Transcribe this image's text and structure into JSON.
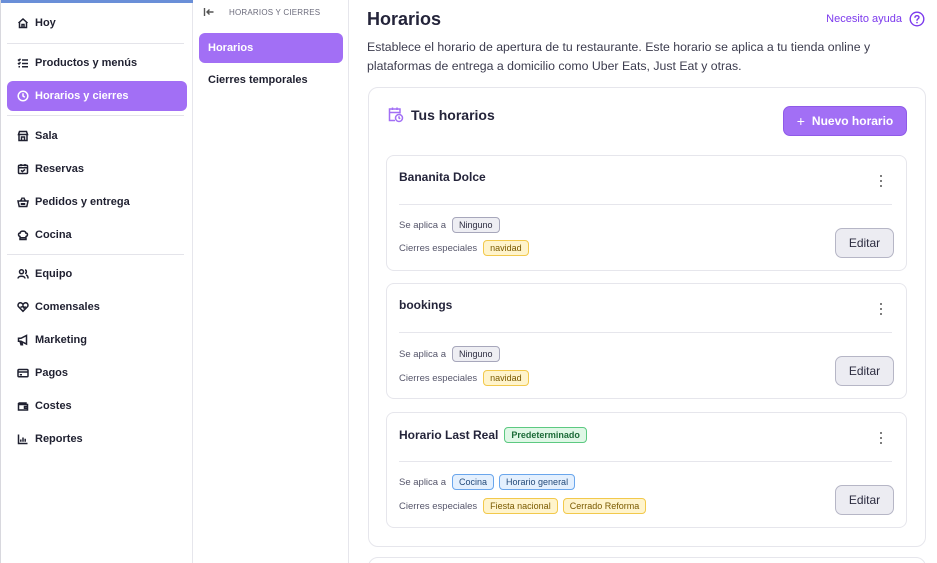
{
  "sidebar": {
    "items": [
      {
        "label": "Hoy",
        "icon": "home-icon"
      },
      {
        "label": "Productos y menús",
        "icon": "list-icon"
      },
      {
        "label": "Horarios y cierres",
        "icon": "clock-icon"
      },
      {
        "label": "Sala",
        "icon": "store-icon"
      },
      {
        "label": "Reservas",
        "icon": "calendar-icon"
      },
      {
        "label": "Pedidos y entrega",
        "icon": "basket-icon"
      },
      {
        "label": "Cocina",
        "icon": "chef-hat-icon"
      },
      {
        "label": "Equipo",
        "icon": "users-icon"
      },
      {
        "label": "Comensales",
        "icon": "heart-icon"
      },
      {
        "label": "Marketing",
        "icon": "megaphone-icon"
      },
      {
        "label": "Pagos",
        "icon": "card-icon"
      },
      {
        "label": "Costes",
        "icon": "wallet-icon"
      },
      {
        "label": "Reportes",
        "icon": "chart-icon"
      }
    ]
  },
  "subpanel": {
    "header": "HORARIOS Y CIERRES",
    "items": [
      {
        "label": "Horarios"
      },
      {
        "label": "Cierres temporales"
      }
    ]
  },
  "main": {
    "title": "Horarios",
    "help_label": "Necesito ayuda",
    "description": "Establece el horario de apertura de tu restaurante. Este horario se aplica a tu tienda online y plataformas de entrega a domicilio como Uber Eats, Just Eat y otras.",
    "card_title": "Tus horarios",
    "new_button_label": "Nuevo horario",
    "applies_label": "Se aplica a",
    "closures_label": "Cierres especiales",
    "edit_label": "Editar",
    "schedules": [
      {
        "name": "Bananita Dolce",
        "badge": "",
        "applies": [
          "Ninguno"
        ],
        "closures": [
          "navidad"
        ]
      },
      {
        "name": "bookings",
        "badge": "",
        "applies": [
          "Ninguno"
        ],
        "closures": [
          "navidad"
        ]
      },
      {
        "name": "Horario Last Real",
        "badge": "Predeterminado",
        "applies": [
          "Cocina",
          "Horario general"
        ],
        "closures": [
          "Fiesta nacional",
          "Cerrado Reforma"
        ]
      }
    ]
  },
  "colors": {
    "accent": "#a26ff5",
    "help_link": "#7c3aed"
  }
}
